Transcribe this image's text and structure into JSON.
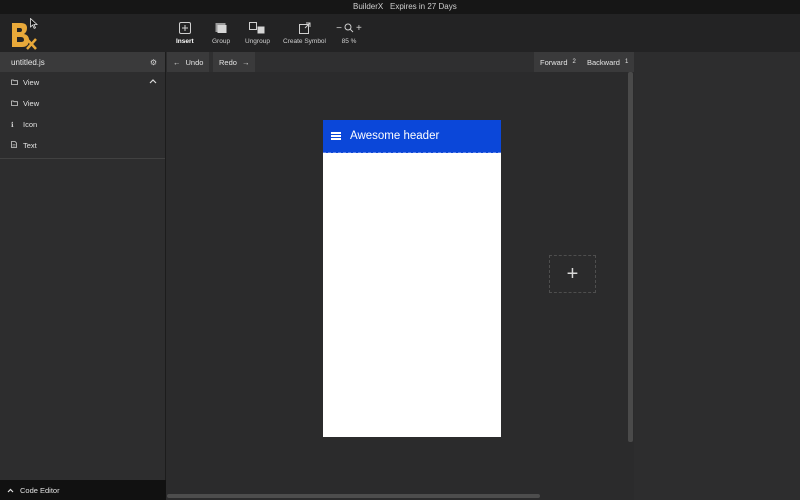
{
  "titlebar": {
    "app_name": "BuilderX",
    "expiry": "Expires in 27 Days"
  },
  "toolbar": {
    "insert": "Insert",
    "group": "Group",
    "ungroup": "Ungroup",
    "create_symbol": "Create Symbol",
    "zoom": "85 %"
  },
  "file": {
    "name": "untitled.js"
  },
  "tree": {
    "items": [
      {
        "icon": "folder-icon",
        "label": "View"
      },
      {
        "icon": "folder-icon",
        "label": "View"
      },
      {
        "icon": "info-icon",
        "label": "Icon"
      },
      {
        "icon": "document-icon",
        "label": "Text"
      }
    ]
  },
  "canvas_bar": {
    "undo": "Undo",
    "redo": "Redo",
    "forward": "Forward",
    "forward_count": "2",
    "backward": "Backward",
    "backward_count": "1"
  },
  "phone": {
    "header_title": "Awesome header"
  },
  "footer": {
    "code_editor": "Code Editor"
  },
  "colors": {
    "accent_header": "#0b47d9",
    "logo": "#e8a93a"
  }
}
